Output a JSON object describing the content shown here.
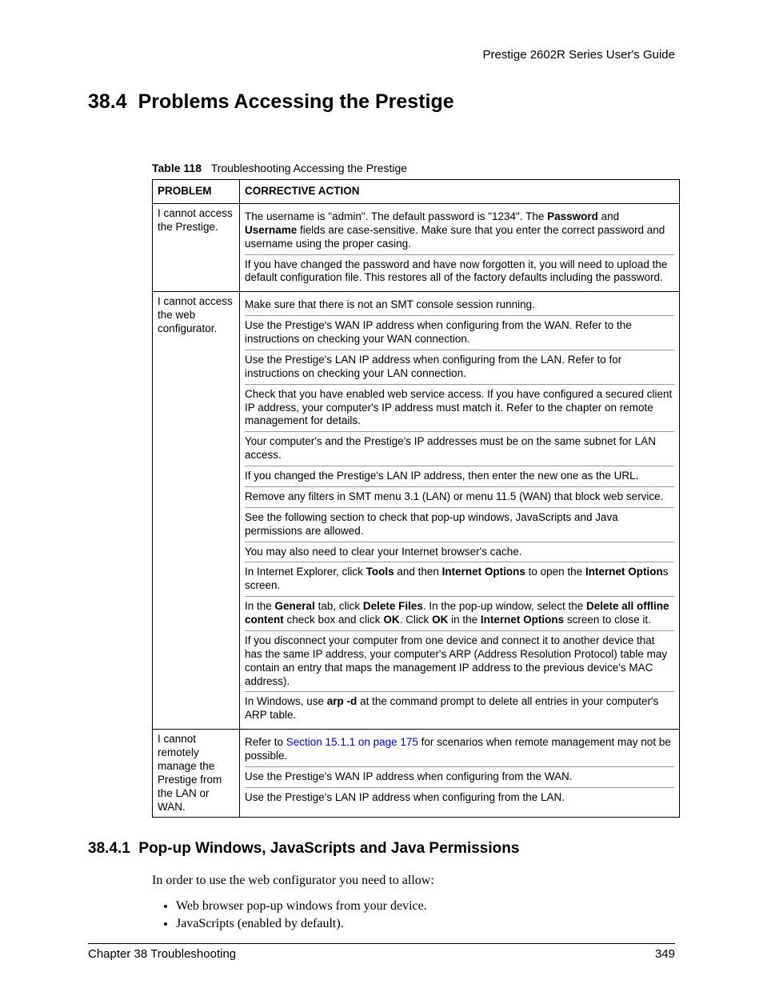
{
  "header": {
    "guide": "Prestige 2602R Series User's Guide"
  },
  "section": {
    "number": "38.4",
    "title": "Problems Accessing the Prestige"
  },
  "table": {
    "label": "Table 118",
    "caption": "Troubleshooting Accessing the Prestige",
    "col1": "PROBLEM",
    "col2": "CORRECTIVE ACTION",
    "rows": [
      {
        "problem": "I cannot access the Prestige.",
        "actions": [
          [
            {
              "t": "The username is \"admin\". The default password is \"1234\". The "
            },
            {
              "t": "Password",
              "b": true
            },
            {
              "t": " and "
            },
            {
              "t": "Username",
              "b": true
            },
            {
              "t": " fields are case-sensitive. Make sure that you enter the correct password and username using the proper casing."
            }
          ],
          [
            {
              "t": "If you have changed the password and have now forgotten it, you will need to upload the default configuration file. This restores all of the factory defaults including the password."
            }
          ]
        ]
      },
      {
        "problem": "I cannot access the web configurator.",
        "actions": [
          [
            {
              "t": "Make sure that there is not an SMT console session running."
            }
          ],
          [
            {
              "t": "Use the Prestige's WAN IP address when configuring from the WAN. Refer to the instructions on checking your WAN connection."
            }
          ],
          [
            {
              "t": "Use the Prestige's LAN IP address when configuring from the LAN. Refer to for instructions on checking your LAN connection."
            }
          ],
          [
            {
              "t": "Check that you have enabled web service access. If you have configured a secured client IP address, your computer's IP address must match it. Refer to the chapter on remote management for details."
            }
          ],
          [
            {
              "t": "Your computer's and the Prestige's IP addresses must be on the same subnet for LAN access."
            }
          ],
          [
            {
              "t": "If you changed the Prestige's LAN IP address, then enter the new one as the URL."
            }
          ],
          [
            {
              "t": "Remove any filters in SMT menu 3.1 (LAN) or menu 11.5 (WAN) that block web service."
            }
          ],
          [
            {
              "t": "See the following section to check that pop-up windows, JavaScripts and Java permissions are allowed."
            }
          ],
          [
            {
              "t": "You may also need to clear your Internet browser's cache."
            }
          ],
          [
            {
              "t": "In Internet Explorer, click "
            },
            {
              "t": "Tools",
              "b": true
            },
            {
              "t": " and then "
            },
            {
              "t": "Internet Options",
              "b": true
            },
            {
              "t": " to open the "
            },
            {
              "t": "Internet Option",
              "b": true
            },
            {
              "t": "s screen."
            }
          ],
          [
            {
              "t": "In the "
            },
            {
              "t": "General",
              "b": true
            },
            {
              "t": " tab, click "
            },
            {
              "t": "Delete Files",
              "b": true
            },
            {
              "t": ". In the pop-up window, select the "
            },
            {
              "t": "Delete all offline content",
              "b": true
            },
            {
              "t": " check box and click "
            },
            {
              "t": "OK",
              "b": true
            },
            {
              "t": ". Click "
            },
            {
              "t": "OK",
              "b": true
            },
            {
              "t": " in the "
            },
            {
              "t": "Internet Options",
              "b": true
            },
            {
              "t": " screen to close it."
            }
          ],
          [
            {
              "t": "If you disconnect your computer from one device and connect it to another device that has the same IP address, your computer's ARP (Address Resolution Protocol) table may contain an entry that maps the management IP address to the previous device's MAC address)."
            }
          ],
          [
            {
              "t": "In Windows, use "
            },
            {
              "t": "arp -d",
              "b": true
            },
            {
              "t": " at the command prompt to delete all entries in your computer's ARP table."
            }
          ]
        ]
      },
      {
        "problem": "I cannot remotely manage the Prestige from the LAN or WAN.",
        "actions": [
          [
            {
              "t": "Refer to "
            },
            {
              "t": "Section 15.1.1 on page 175",
              "xref": true
            },
            {
              "t": " for scenarios when remote management may not be possible."
            }
          ],
          [
            {
              "t": "Use the Prestige's WAN IP address when configuring from the WAN."
            }
          ],
          [
            {
              "t": "Use the Prestige's LAN IP address when configuring from the LAN."
            }
          ]
        ]
      }
    ]
  },
  "subsection": {
    "number": "38.4.1",
    "title": "Pop-up Windows, JavaScripts and Java Permissions"
  },
  "body": {
    "intro": "In order to use the web configurator you need to allow:",
    "bullets": [
      "Web browser pop-up windows from your device.",
      "JavaScripts (enabled by default)."
    ]
  },
  "footer": {
    "chapter": "Chapter 38 Troubleshooting",
    "page": "349"
  }
}
